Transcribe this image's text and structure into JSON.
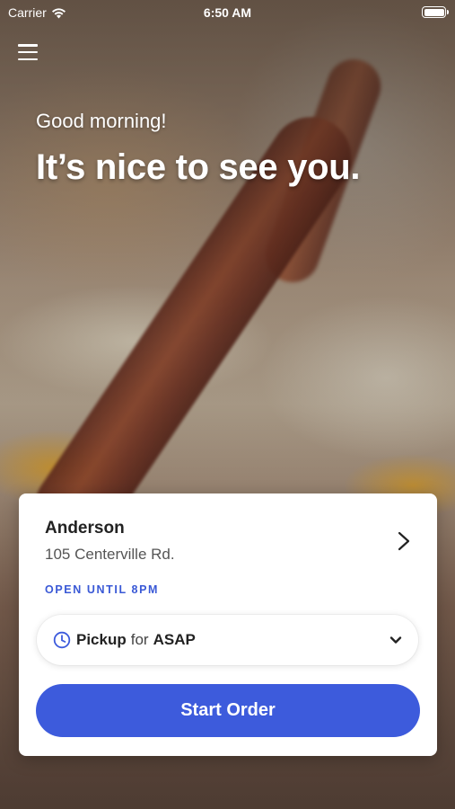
{
  "status_bar": {
    "carrier": "Carrier",
    "time": "6:50 AM",
    "icons": [
      "wifi-icon",
      "battery-icon"
    ]
  },
  "header": {
    "menu_icon": "hamburger-menu-icon",
    "greeting": "Good morning!",
    "headline": "It’s nice to see you."
  },
  "store": {
    "name": "Anderson",
    "address": "105 Centerville Rd.",
    "hours": "OPEN UNTIL 8PM"
  },
  "order_type": {
    "mode": "Pickup",
    "connector": "for",
    "time": "ASAP"
  },
  "actions": {
    "start_order_label": "Start Order"
  },
  "colors": {
    "accent": "#3d5bdc",
    "hours_text": "#3a59d6"
  }
}
